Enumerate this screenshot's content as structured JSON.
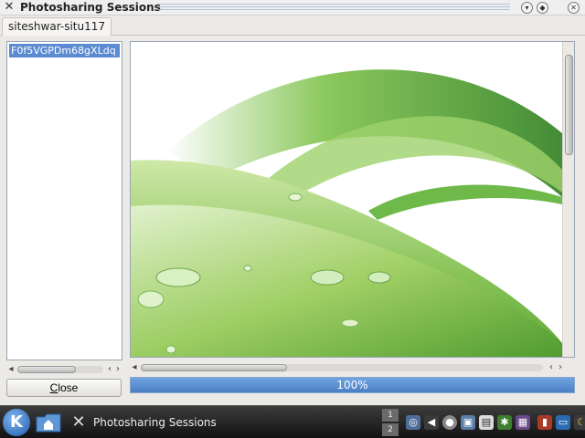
{
  "window": {
    "title": "Photosharing Sessions"
  },
  "tabs": [
    {
      "label": "siteshwar-situ117"
    }
  ],
  "session_list": {
    "items": [
      {
        "label": "F0f5VGPDm68gXLdq"
      }
    ]
  },
  "close_button": {
    "label_prefix": "",
    "label_underlined": "C",
    "label_rest": "lose"
  },
  "progress": {
    "value": 1.0,
    "label": "100%"
  },
  "taskbar": {
    "task_label": "Photosharing Sessions",
    "pager": [
      "1",
      "2"
    ]
  },
  "colors": {
    "accent": "#4a7fc6",
    "selection": "#5b8bd1"
  }
}
